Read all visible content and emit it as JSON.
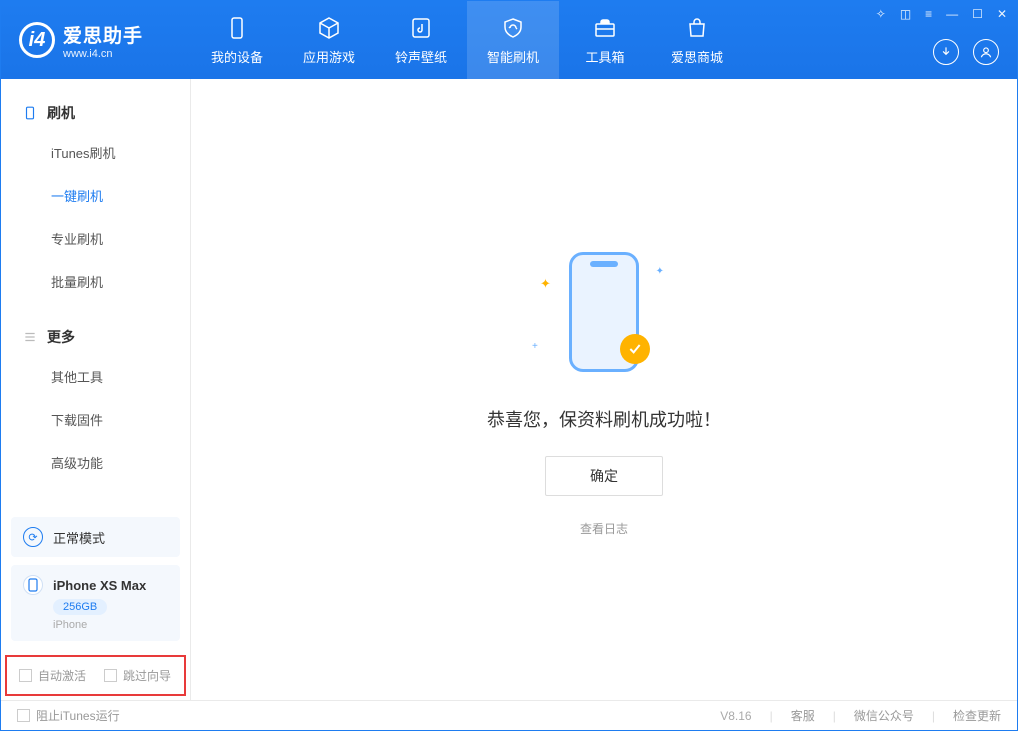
{
  "app": {
    "title": "爱思助手",
    "url": "www.i4.cn"
  },
  "nav": {
    "items": [
      {
        "label": "我的设备"
      },
      {
        "label": "应用游戏"
      },
      {
        "label": "铃声壁纸"
      },
      {
        "label": "智能刷机"
      },
      {
        "label": "工具箱"
      },
      {
        "label": "爱思商城"
      }
    ]
  },
  "sidebar": {
    "section1": {
      "title": "刷机",
      "items": [
        "iTunes刷机",
        "一键刷机",
        "专业刷机",
        "批量刷机"
      ]
    },
    "section2": {
      "title": "更多",
      "items": [
        "其他工具",
        "下载固件",
        "高级功能"
      ]
    }
  },
  "device": {
    "mode": "正常模式",
    "name": "iPhone XS Max",
    "storage": "256GB",
    "type": "iPhone"
  },
  "options": {
    "auto_activate": "自动激活",
    "skip_guide": "跳过向导"
  },
  "main": {
    "success_msg": "恭喜您，保资料刷机成功啦！",
    "ok_btn": "确定",
    "log_link": "查看日志"
  },
  "footer": {
    "block_itunes": "阻止iTunes运行",
    "version": "V8.16",
    "links": [
      "客服",
      "微信公众号",
      "检查更新"
    ]
  }
}
